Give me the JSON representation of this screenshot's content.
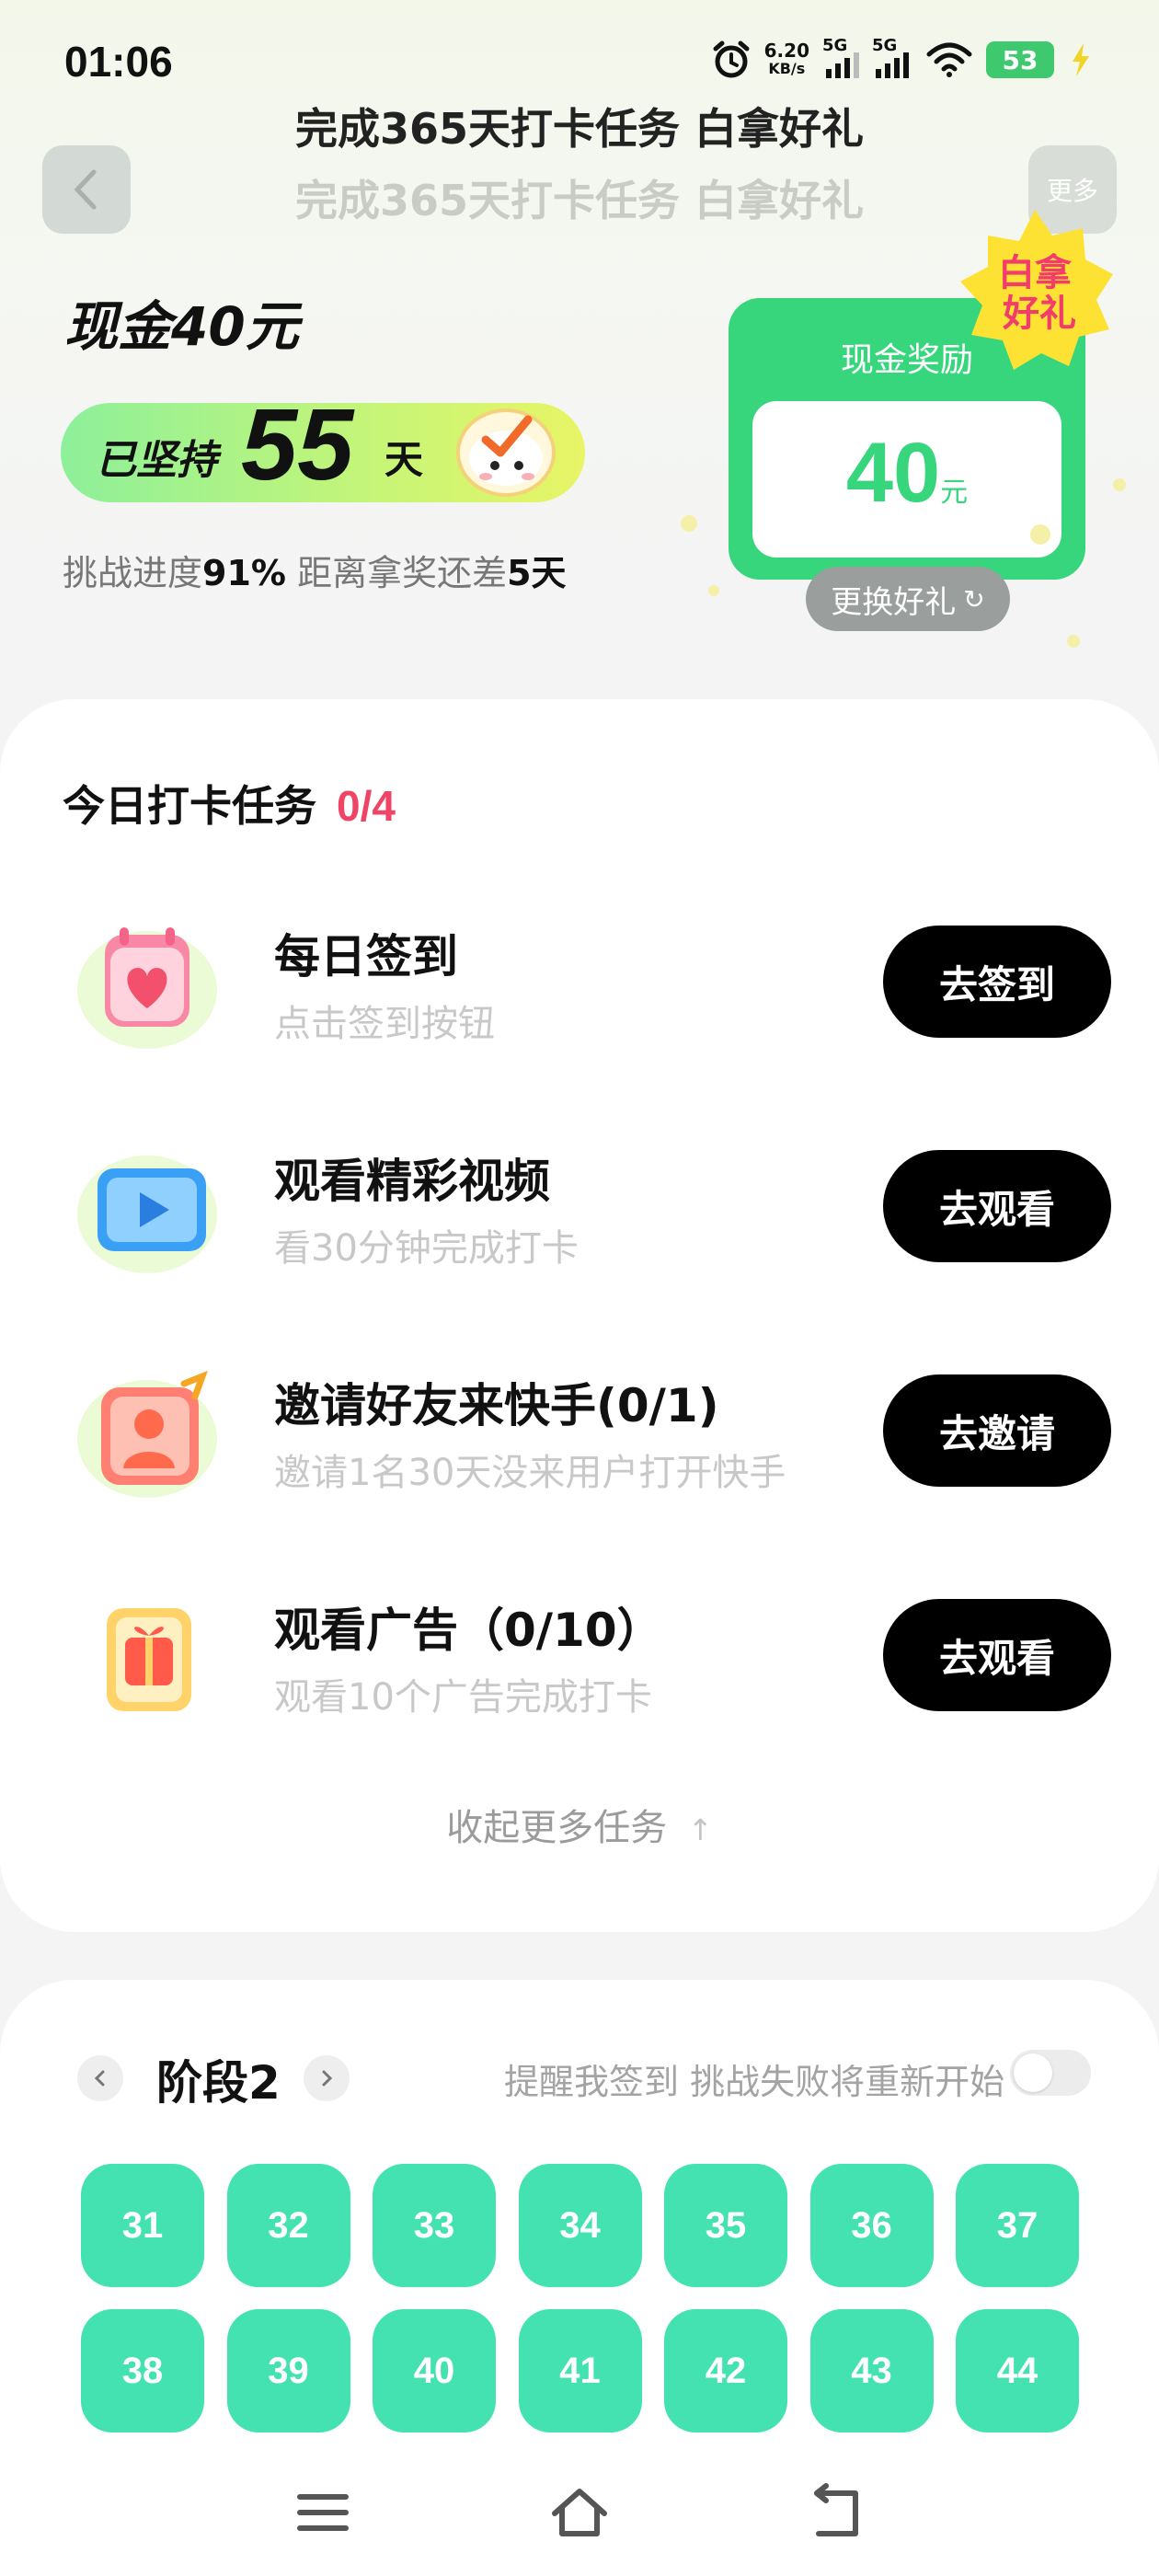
{
  "status_bar": {
    "time": "01:06",
    "net_speed_value": "6.20",
    "net_speed_unit": "KB/s",
    "sim1_label": "5G",
    "sim2_label": "5G",
    "battery": "53"
  },
  "header": {
    "title": "完成365天打卡任务 白拿好礼",
    "title_shadow": "完成365天打卡任务 白拿好礼",
    "more_label": "更多"
  },
  "hero": {
    "cash_title": "现金40元",
    "persist_prefix": "已坚持",
    "persist_days": "55",
    "persist_suffix": "天",
    "progress_prefix": "挑战进度",
    "progress_percent": "91%",
    "progress_mid": " 距离拿奖还差",
    "progress_remaining": "5天"
  },
  "reward": {
    "title": "现金奖励",
    "amount": "40",
    "unit": "元",
    "badge_line1": "白拿",
    "badge_line2": "好礼",
    "change_label": "更换好礼",
    "change_icon": "↻"
  },
  "tasks": {
    "heading": "今日打卡任务",
    "count": "0/4",
    "items": [
      {
        "name": "每日签到",
        "desc": "点击签到按钮",
        "button": "去签到",
        "icon": "calendar-heart-icon"
      },
      {
        "name": "观看精彩视频",
        "desc": "看30分钟完成打卡",
        "button": "去观看",
        "icon": "video-play-icon"
      },
      {
        "name": "邀请好友来快手(0/1)",
        "desc": "邀请1名30天没来用户打开快手",
        "button": "去邀请",
        "icon": "invite-user-icon"
      },
      {
        "name": "观看广告（0/10）",
        "desc": "观看10个广告完成打卡",
        "button": "去观看",
        "icon": "gift-box-icon"
      }
    ],
    "collapse_label": "收起更多任务",
    "collapse_icon": "↑"
  },
  "stage": {
    "label": "阶段2",
    "remind_text": "提醒我签到 挑战失败将重新开始",
    "remind_enabled": false,
    "days": [
      "31",
      "32",
      "33",
      "34",
      "35",
      "36",
      "37",
      "38",
      "39",
      "40",
      "41",
      "42",
      "43",
      "44"
    ]
  },
  "colors": {
    "accent_green": "#37d67d",
    "day_tile": "#43e2b0",
    "task_count": "#f04466",
    "button_black": "#000000"
  }
}
